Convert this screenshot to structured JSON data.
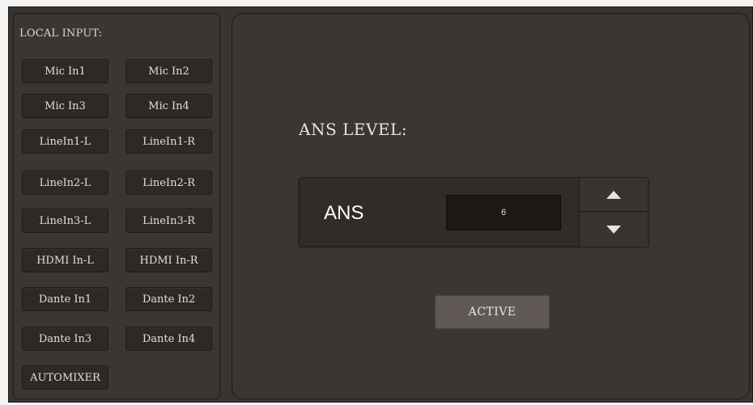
{
  "local_input": {
    "label": "LOCAL INPUT:",
    "buttons": [
      "Mic In1",
      "Mic In2",
      "Mic In3",
      "Mic In4",
      "LineIn1-L",
      "LineIn1-R",
      "LineIn2-L",
      "LineIn2-R",
      "LineIn3-L",
      "LineIn3-R",
      "HDMI In-L",
      "HDMI In-R",
      "Dante In1",
      "Dante In2",
      "Dante In3",
      "Dante In4",
      "AUTOMIXER"
    ]
  },
  "ans": {
    "section_label": "ANS LEVEL:",
    "name": "ANS",
    "value": "6"
  },
  "active_label": "ACTIVE",
  "colors": {
    "panel": "#3c3632",
    "button": "#2e2926",
    "active_button": "#605956",
    "value_box": "#1c1816"
  }
}
